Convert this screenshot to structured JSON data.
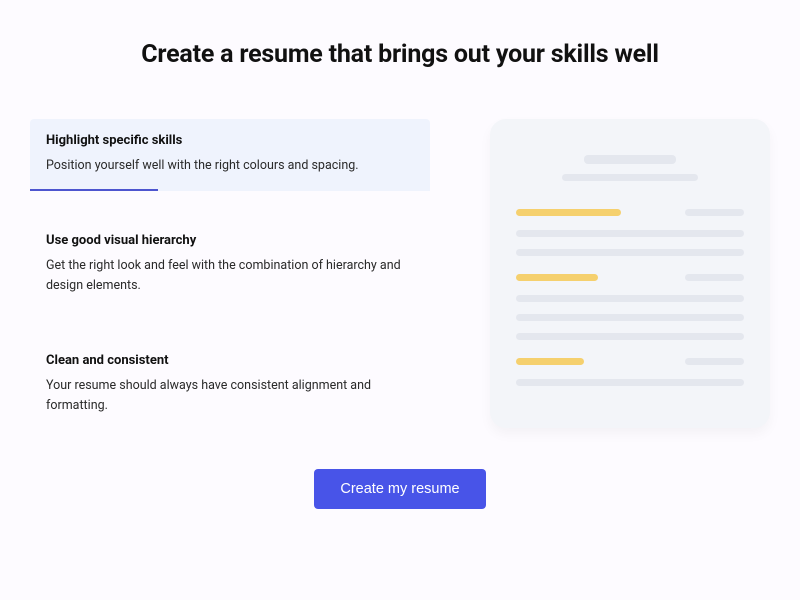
{
  "title": "Create a resume that brings out your skills well",
  "tabs": [
    {
      "title": "Highlight specific skills",
      "desc": "Position yourself well with the right colours and spacing."
    },
    {
      "title": "Use good visual hierarchy",
      "desc": "Get the right look and feel with the combination of hierarchy and design elements."
    },
    {
      "title": "Clean and consistent",
      "desc": "Your resume should always have consistent alignment and formatting."
    }
  ],
  "cta": "Create my resume"
}
